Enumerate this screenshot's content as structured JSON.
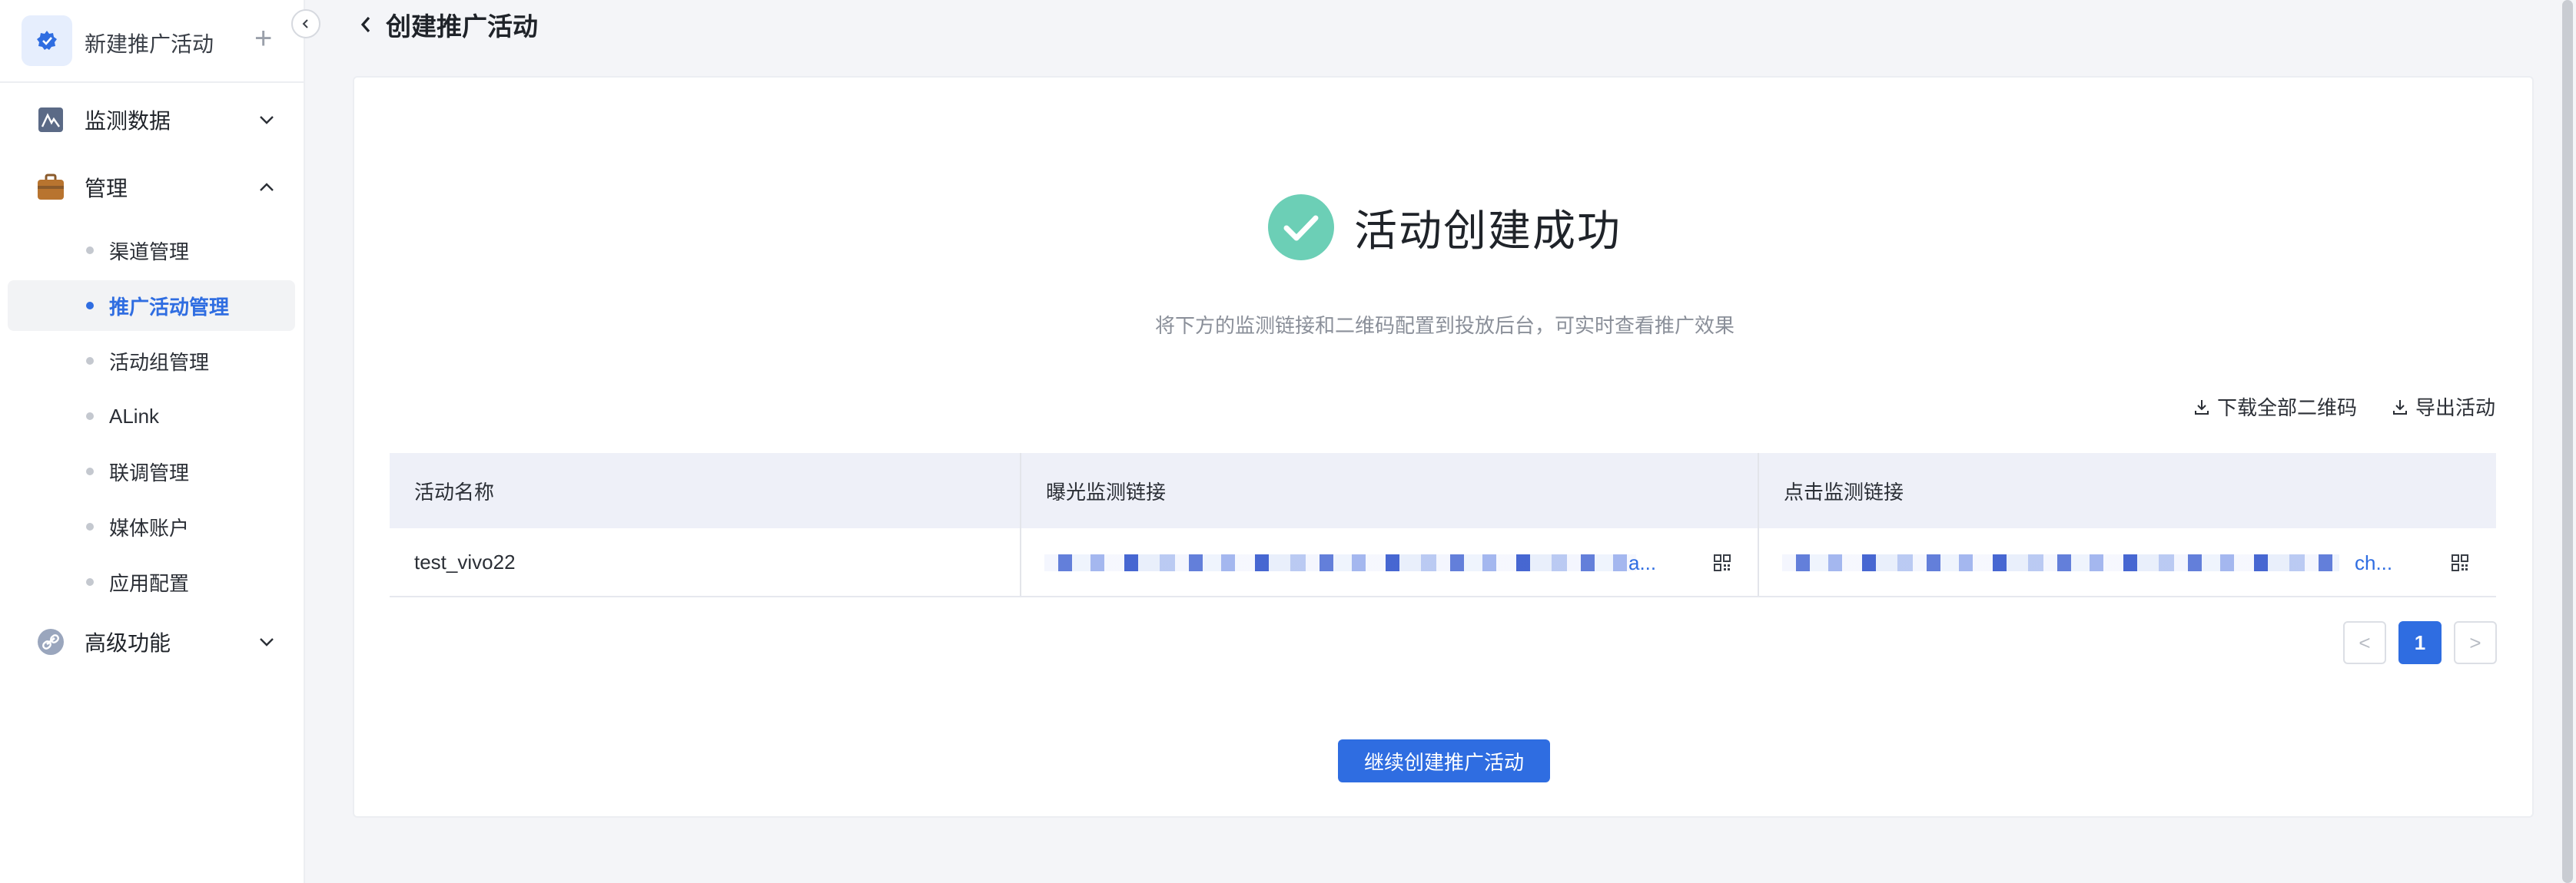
{
  "sidebar": {
    "title": "新建推广活动",
    "plus": "+",
    "groups": {
      "monitor": {
        "label": "监测数据",
        "icon": "chart-icon"
      },
      "manage": {
        "label": "管理",
        "icon": "briefcase-icon"
      },
      "advanced": {
        "label": "高级功能",
        "icon": "link-icon"
      }
    },
    "items": [
      {
        "label": "渠道管理"
      },
      {
        "label": "推广活动管理",
        "active": true
      },
      {
        "label": "活动组管理"
      },
      {
        "label": "ALink"
      },
      {
        "label": "联调管理"
      },
      {
        "label": "媒体账户"
      },
      {
        "label": "应用配置"
      }
    ]
  },
  "header": {
    "title": "创建推广活动"
  },
  "result": {
    "title": "活动创建成功",
    "subtitle": "将下方的监测链接和二维码配置到投放后台，可实时查看推广效果",
    "status_color": "#6ccfb6"
  },
  "actions": {
    "download_all_qr": "下载全部二维码",
    "export_activity": "导出活动"
  },
  "table": {
    "headers": [
      "活动名称",
      "曝光监测链接",
      "点击监测链接"
    ],
    "rows": [
      {
        "name": "test_vivo22",
        "impression_tail": "a...",
        "click_tail": "ch..."
      }
    ]
  },
  "pagination": {
    "prev": "<",
    "current": "1",
    "next": ">"
  },
  "continue_button": "继续创建推广活动",
  "colors": {
    "accent": "#2f6de1",
    "success": "#6ccfb6"
  }
}
